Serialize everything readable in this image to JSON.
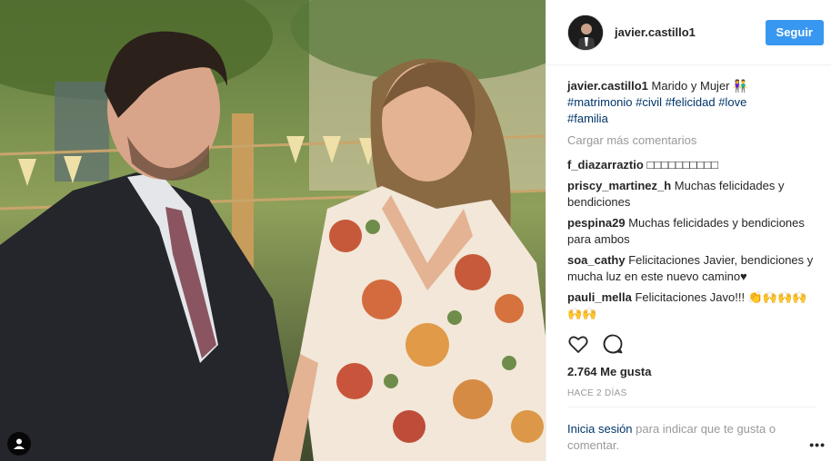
{
  "post": {
    "username": "javier.castillo1",
    "follow_label": "Seguir",
    "caption": {
      "user": "javier.castillo1",
      "text": "Marido y Mujer 👫",
      "hashtags": [
        "#matrimonio",
        "#civil",
        "#felicidad",
        "#love",
        "#familia"
      ]
    },
    "load_more": "Cargar más comentarios",
    "comments": [
      {
        "user": "f_diazarraztio",
        "text": "□□□□□□□□□□"
      },
      {
        "user": "priscy_martinez_h",
        "text": "Muchas felicidades y bendiciones"
      },
      {
        "user": "pespina29",
        "text": "Muchas felicidades y bendiciones para ambos"
      },
      {
        "user": "soa_cathy",
        "text": "Felicitaciones Javier, bendiciones y mucha luz en este nuevo camino♥"
      },
      {
        "user": "pauli_mella",
        "text": "Felicitaciones Javo!!! 👏🙌🙌🙌 🙌🙌"
      }
    ],
    "likes": "2.764 Me gusta",
    "time": "HACE 2 DÍAS",
    "login_link": "Inicia sesión",
    "login_text": " para indicar que te gusta o comentar.",
    "more_options": "•••"
  },
  "icons": {
    "like": "heart-icon",
    "comment": "comment-icon",
    "tag": "user-tag-icon"
  }
}
